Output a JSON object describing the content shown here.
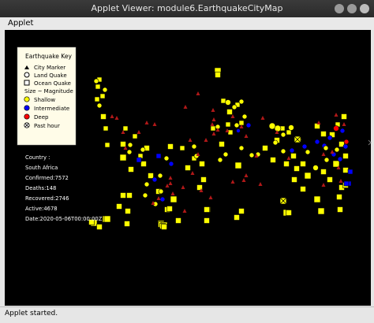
{
  "window": {
    "title": "Applet Viewer: module6.EarthquakeCityMap",
    "menu": "Applet",
    "status": "Applet started."
  },
  "legend": {
    "title": "Earthquake Key",
    "items": [
      {
        "icon": "triangle",
        "label": "City Marker"
      },
      {
        "icon": "circle",
        "label": "Land Quake"
      },
      {
        "icon": "square",
        "label": "Ocean Quake"
      },
      {
        "icon": "none",
        "label": "Size ~ Magnitude"
      },
      {
        "icon": "yellow-circle",
        "label": "Shallow"
      },
      {
        "icon": "blue-circle",
        "label": "Intermediate"
      },
      {
        "icon": "red-circle",
        "label": "Deep"
      },
      {
        "icon": "x-circle",
        "label": "Past hour"
      }
    ],
    "colors": {
      "shallow": "#ffff00",
      "intermediate": "#0000ff",
      "deep": "#ff0000",
      "city": "#b01818",
      "panel": "#fffce8"
    }
  },
  "info": {
    "lines": [
      "Country :",
      "South Africa",
      "Confirmed:7572",
      "Deaths:148",
      "Recovered:2746",
      "Active:4678",
      "Date:2020-05-06T00:00:00Z"
    ]
  }
}
